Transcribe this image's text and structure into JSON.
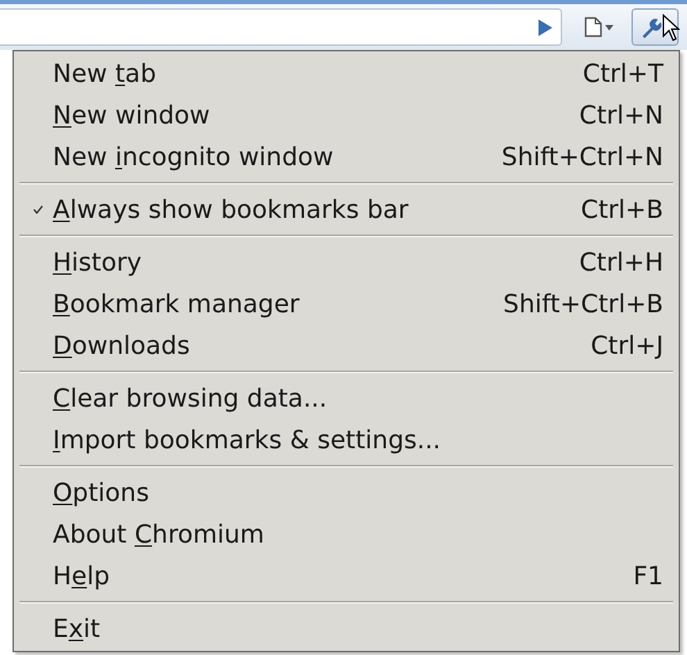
{
  "menu": {
    "sections": [
      {
        "items": [
          {
            "label": {
              "before": "New ",
              "key": "t",
              "after": "ab"
            },
            "shortcut": "Ctrl+T",
            "checked": false
          },
          {
            "label": {
              "key": "N",
              "after": "ew window"
            },
            "shortcut": "Ctrl+N",
            "checked": false
          },
          {
            "label": {
              "before": "New ",
              "key": "i",
              "after": "ncognito window"
            },
            "shortcut": "Shift+Ctrl+N",
            "checked": false
          }
        ]
      },
      {
        "items": [
          {
            "label": {
              "key": "A",
              "after": "lways show bookmarks bar"
            },
            "shortcut": "Ctrl+B",
            "checked": true
          }
        ]
      },
      {
        "items": [
          {
            "label": {
              "key": "H",
              "after": "istory"
            },
            "shortcut": "Ctrl+H",
            "checked": false
          },
          {
            "label": {
              "key": "B",
              "after": "ookmark manager"
            },
            "shortcut": "Shift+Ctrl+B",
            "checked": false
          },
          {
            "label": {
              "key": "D",
              "after": "ownloads"
            },
            "shortcut": "Ctrl+J",
            "checked": false
          }
        ]
      },
      {
        "items": [
          {
            "label": {
              "key": "C",
              "after": "lear browsing data..."
            },
            "checked": false
          },
          {
            "label": {
              "key": "I",
              "after": "mport bookmarks & settings..."
            },
            "checked": false
          }
        ]
      },
      {
        "items": [
          {
            "label": {
              "key": "O",
              "after": "ptions"
            },
            "checked": false
          },
          {
            "label": {
              "before": "About ",
              "key": "C",
              "after": "hromium"
            },
            "checked": false
          },
          {
            "label": {
              "before": "H",
              "key": "e",
              "after": "lp"
            },
            "shortcut": "F1",
            "checked": false
          }
        ]
      },
      {
        "items": [
          {
            "label": {
              "before": "E",
              "key": "x",
              "after": "it"
            },
            "checked": false
          }
        ]
      }
    ]
  }
}
